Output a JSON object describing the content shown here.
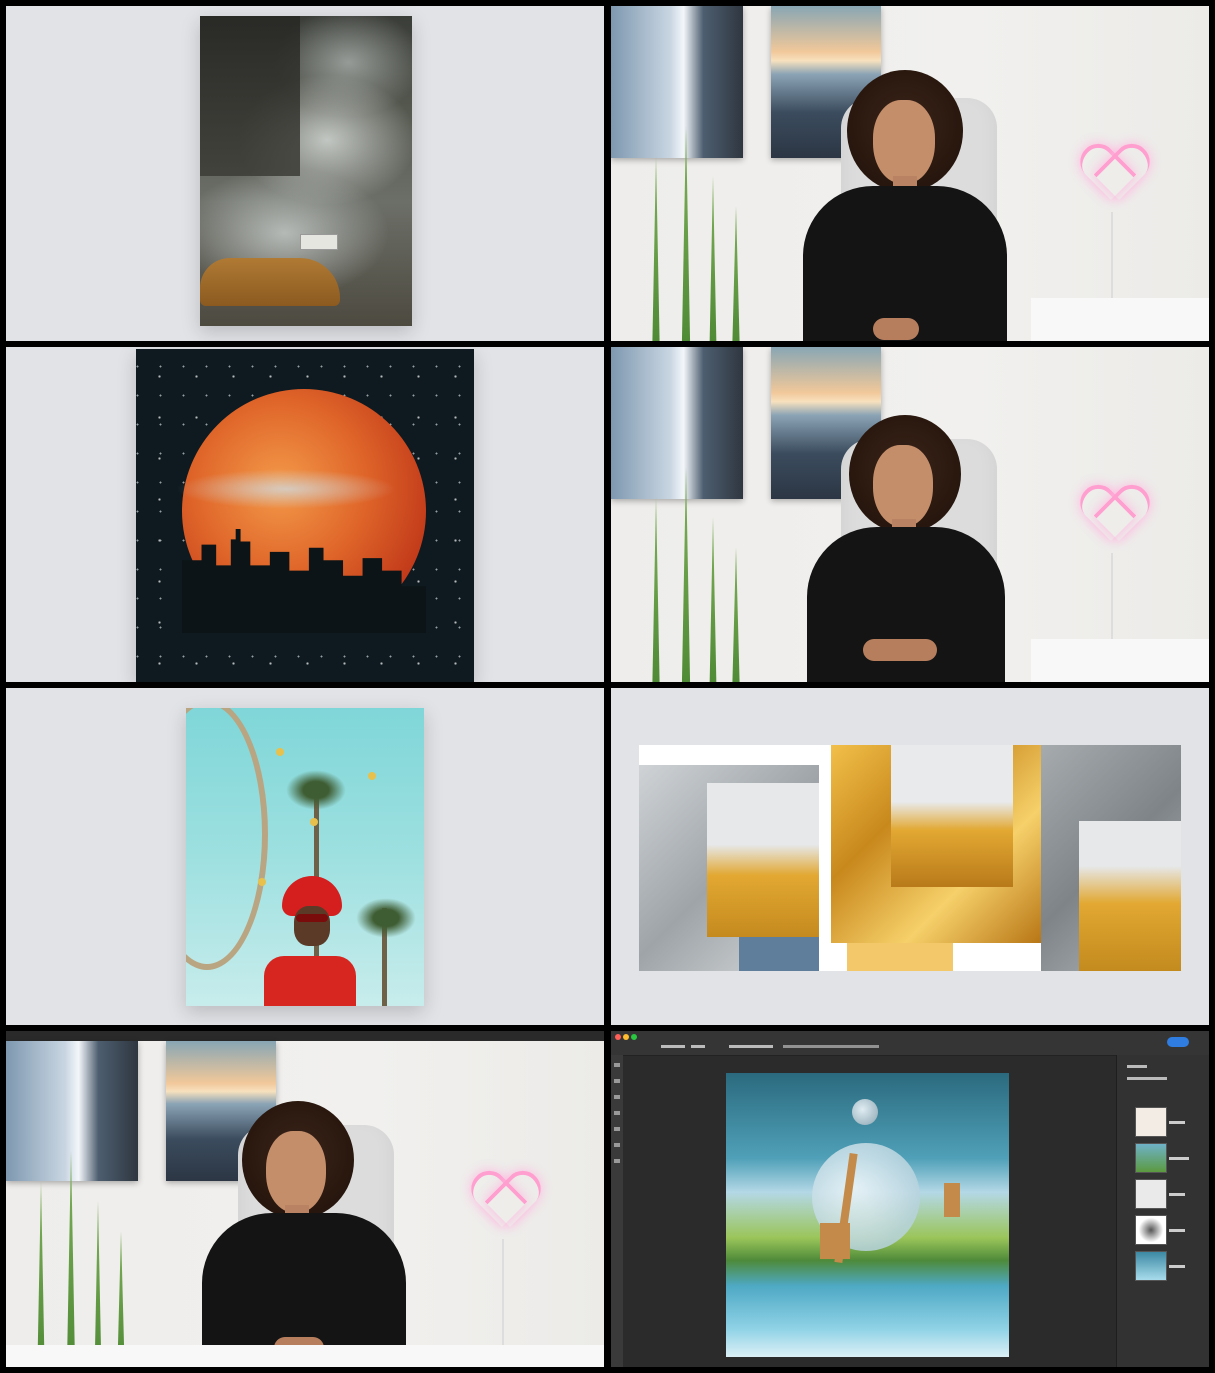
{
  "frames": [
    {
      "id": "smoke-taxi",
      "kind": "photo-card"
    },
    {
      "id": "vlog-1",
      "kind": "presenter"
    },
    {
      "id": "blood-moon",
      "kind": "photo-card"
    },
    {
      "id": "vlog-2",
      "kind": "presenter"
    },
    {
      "id": "red-hat-palms",
      "kind": "photo-card"
    },
    {
      "id": "yellow-jacket-collage",
      "kind": "collage"
    },
    {
      "id": "vlog-3",
      "kind": "presenter"
    },
    {
      "id": "giraffe-waterfall-editor",
      "kind": "editor-screen"
    }
  ],
  "colors": {
    "studio_gray": "#e1e3e7",
    "moon_orange": "#e0672a",
    "hat_red": "#d51f1f",
    "jacket_yellow": "#e2a832",
    "neon_pink": "#ff9fd0",
    "editor_dark": "#2b2b2b",
    "accent_blue": "#2f7de1"
  }
}
